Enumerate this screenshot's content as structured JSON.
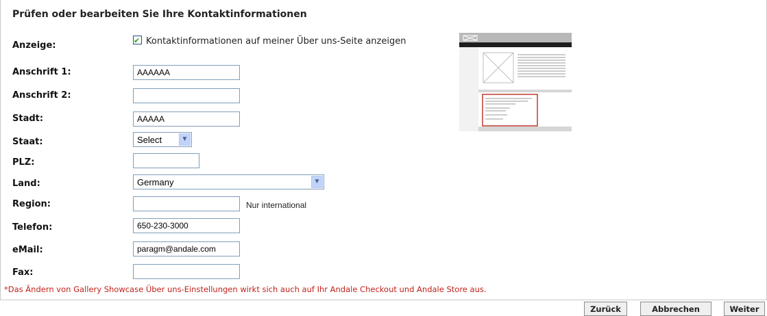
{
  "page": {
    "title": "Prüfen oder bearbeiten Sie Ihre Kontaktinformationen"
  },
  "form": {
    "anzeige_label": "Anzeige:",
    "anzeige_checkbox_label": "Kontaktinformationen auf meiner Über uns-Seite anzeigen",
    "anzeige_checked": true,
    "anschrift1_label": "Anschrift 1:",
    "anschrift1_value": "AAAAAA",
    "anschrift2_label": "Anschrift 2:",
    "anschrift2_value": "",
    "stadt_label": "Stadt:",
    "stadt_value": "AAAAA",
    "staat_label": "Staat:",
    "staat_value": "Select",
    "plz_label": "PLZ:",
    "plz_value": "",
    "land_label": "Land:",
    "land_value": "Germany",
    "region_label": "Region:",
    "region_value": "",
    "region_hint": "Nur international",
    "telefon_label": "Telefon:",
    "telefon_value": "650-230-3000",
    "email_label": "eMail:",
    "email_value": "paragm@andale.com",
    "fax_label": "Fax:",
    "fax_value": ""
  },
  "note": "*Das Ändern von Gallery Showcase Über uns-Einstellungen wirkt sich auch auf Ihr Andale Checkout und Andale Store aus.",
  "buttons": {
    "back": "Zurück",
    "cancel": "Abbrechen",
    "next": "Weiter"
  },
  "colors": {
    "note": "#c0221b",
    "preview_highlight": "#c0392b",
    "input_border": "#7f9db9"
  }
}
